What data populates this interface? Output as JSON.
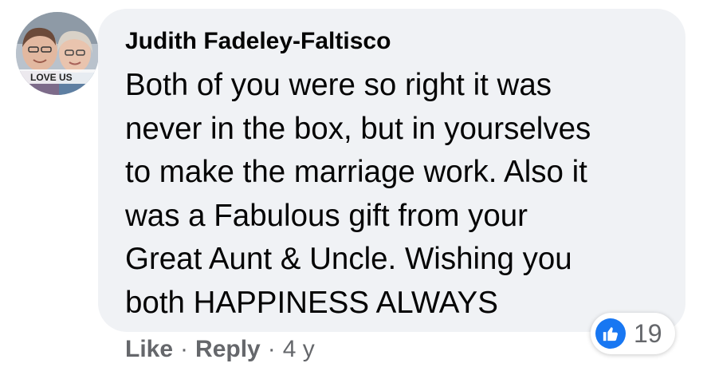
{
  "comment": {
    "author": "Judith Fadeley-Faltisco",
    "avatar_caption": "LOVE US",
    "text_lines": [
      "Both of you were so right it was",
      "never in the box, but in yourselves",
      "to make the marriage work. Also it",
      "was a Fabulous gift from your",
      "Great Aunt & Uncle. Wishing you",
      "both HAPPINESS ALWAYS"
    ]
  },
  "reactions": {
    "icon": "thumbs-up-icon",
    "count": "19",
    "color": "#1877f2"
  },
  "actions": {
    "like_label": "Like",
    "reply_label": "Reply",
    "separator": "·",
    "age": "4 y"
  },
  "colors": {
    "bubble": "#f0f2f5",
    "text": "#050505",
    "secondary_text": "#65676b"
  }
}
